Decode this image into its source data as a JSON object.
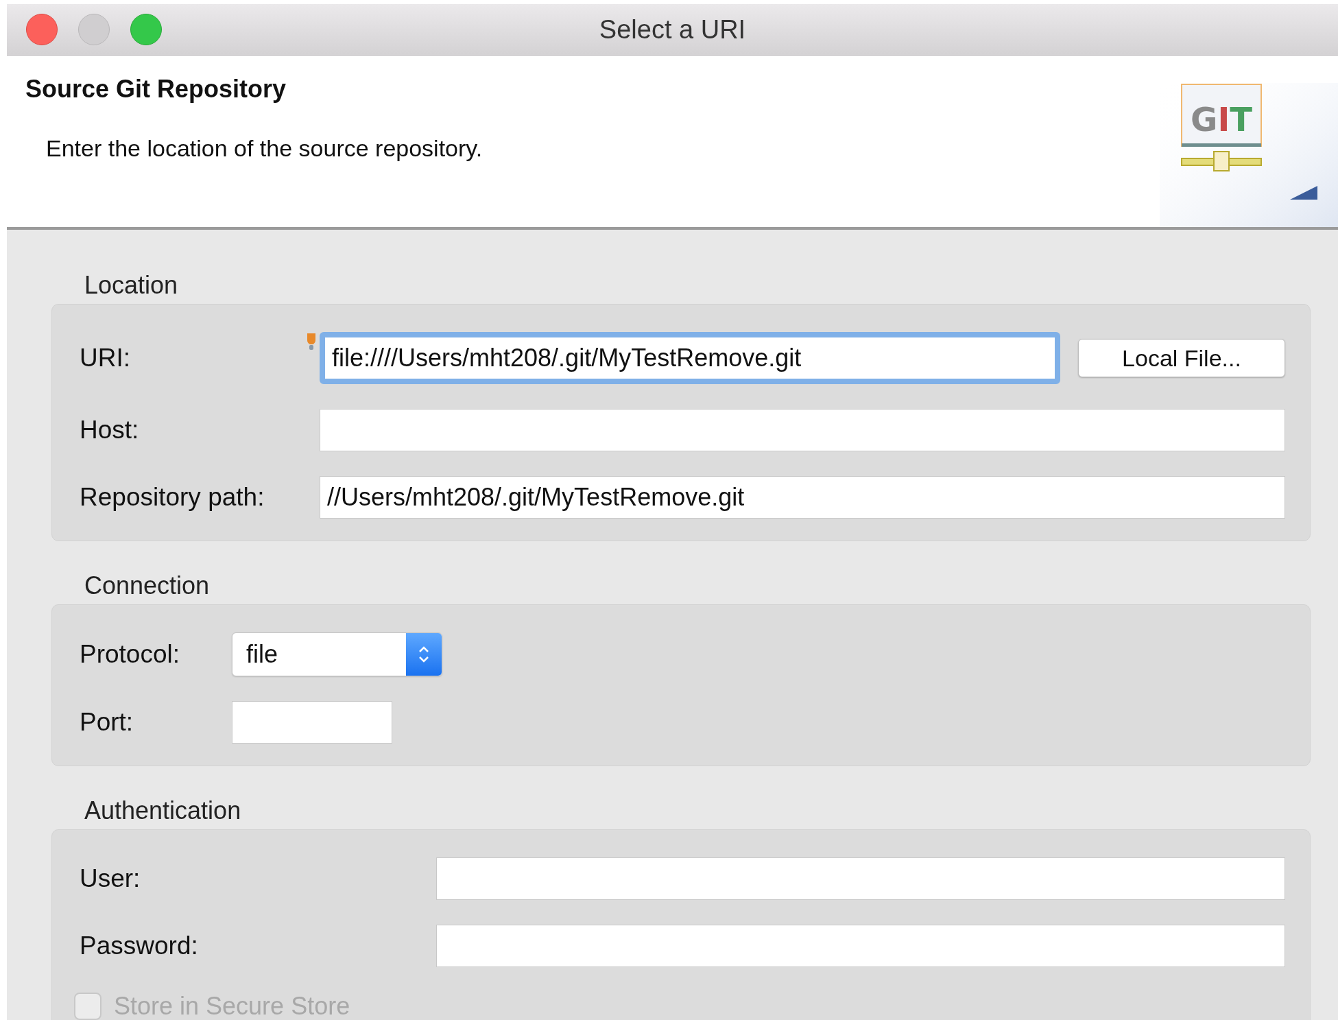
{
  "window": {
    "title": "Select a URI"
  },
  "header": {
    "title": "Source Git Repository",
    "description": "Enter the location of the source repository.",
    "logo_text": "GIT"
  },
  "groups": [
    {
      "title": "Location",
      "fields": [
        {
          "kind": "text",
          "label": "URI:",
          "value": "file:////Users/mht208/.git/MyTestRemove.git",
          "focused": true,
          "hint_icon": true,
          "button": "Local File..."
        },
        {
          "kind": "text",
          "label": "Host:",
          "focused": false
        },
        {
          "kind": "text",
          "label": "Repository path:",
          "value": "//Users/mht208/.git/MyTestRemove.git",
          "focused": false
        }
      ]
    },
    {
      "title": "Connection",
      "fields": [
        {
          "kind": "select",
          "label": "Protocol:",
          "value": "file"
        },
        {
          "kind": "short_text",
          "label": "Port:",
          "focused": false
        }
      ]
    },
    {
      "title": "Authentication",
      "fields": [
        {
          "kind": "text",
          "label": "User:",
          "focused": false
        },
        {
          "kind": "text",
          "label": "Password:",
          "focused": false
        },
        {
          "kind": "checkbox",
          "label": "Store in Secure Store",
          "checked": false,
          "disabled": true
        }
      ]
    }
  ]
}
